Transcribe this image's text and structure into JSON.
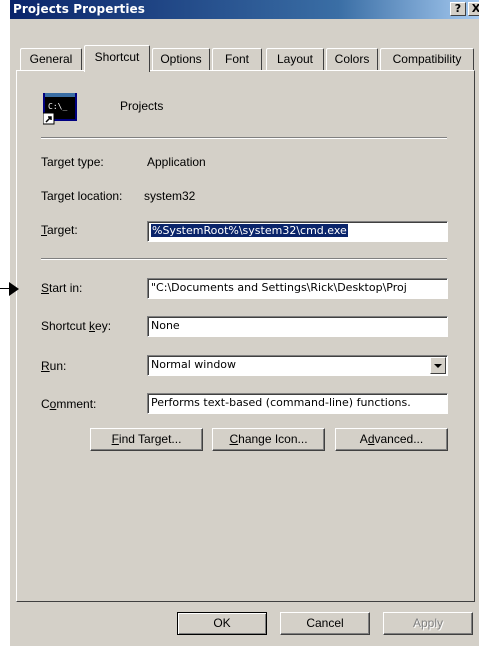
{
  "window": {
    "title": "Projects Properties",
    "help_glyph": "?",
    "close_glyph": "X"
  },
  "tabs": [
    {
      "label": "General",
      "active": false
    },
    {
      "label": "Shortcut",
      "active": true
    },
    {
      "label": "Options",
      "active": false
    },
    {
      "label": "Font",
      "active": false
    },
    {
      "label": "Layout",
      "active": false
    },
    {
      "label": "Colors",
      "active": false
    },
    {
      "label": "Compatibility",
      "active": false
    }
  ],
  "shortcut": {
    "name": "Projects",
    "icon_text": "C:\\_",
    "icon_name": "cmd-shortcut-icon",
    "target_type_label": "Target type:",
    "target_type_value": "Application",
    "target_location_label": "Target location:",
    "target_location_value": "system32",
    "target_label_key": "T",
    "target_label_rest": "arget:",
    "target_value": "%SystemRoot%\\system32\\cmd.exe",
    "start_in_label_key": "S",
    "start_in_label_rest": "tart in:",
    "start_in_value": "\"C:\\Documents and Settings\\Rick\\Desktop\\Proj",
    "shortcut_key_label_pre": "Shortcut ",
    "shortcut_key_label_key": "k",
    "shortcut_key_label_post": "ey:",
    "shortcut_key_value": "None",
    "run_label_key": "R",
    "run_label_rest": "un:",
    "run_value": "Normal window",
    "comment_label_pre": "C",
    "comment_label_key": "o",
    "comment_label_post": "mment:",
    "comment_value": "Performs text-based (command-line) functions."
  },
  "buttons": {
    "find_target_key": "F",
    "find_target_rest": "ind Target...",
    "change_icon_key": "C",
    "change_icon_rest": "hange Icon...",
    "advanced_pre": "A",
    "advanced_key": "d",
    "advanced_post": "vanced...",
    "ok": "OK",
    "cancel": "Cancel",
    "apply": "Apply"
  },
  "colors": {
    "title_gradient_start": "#0a246a",
    "title_gradient_end": "#a6caf0",
    "dialog_face": "#d4d0c8",
    "selection": "#0a246a"
  }
}
